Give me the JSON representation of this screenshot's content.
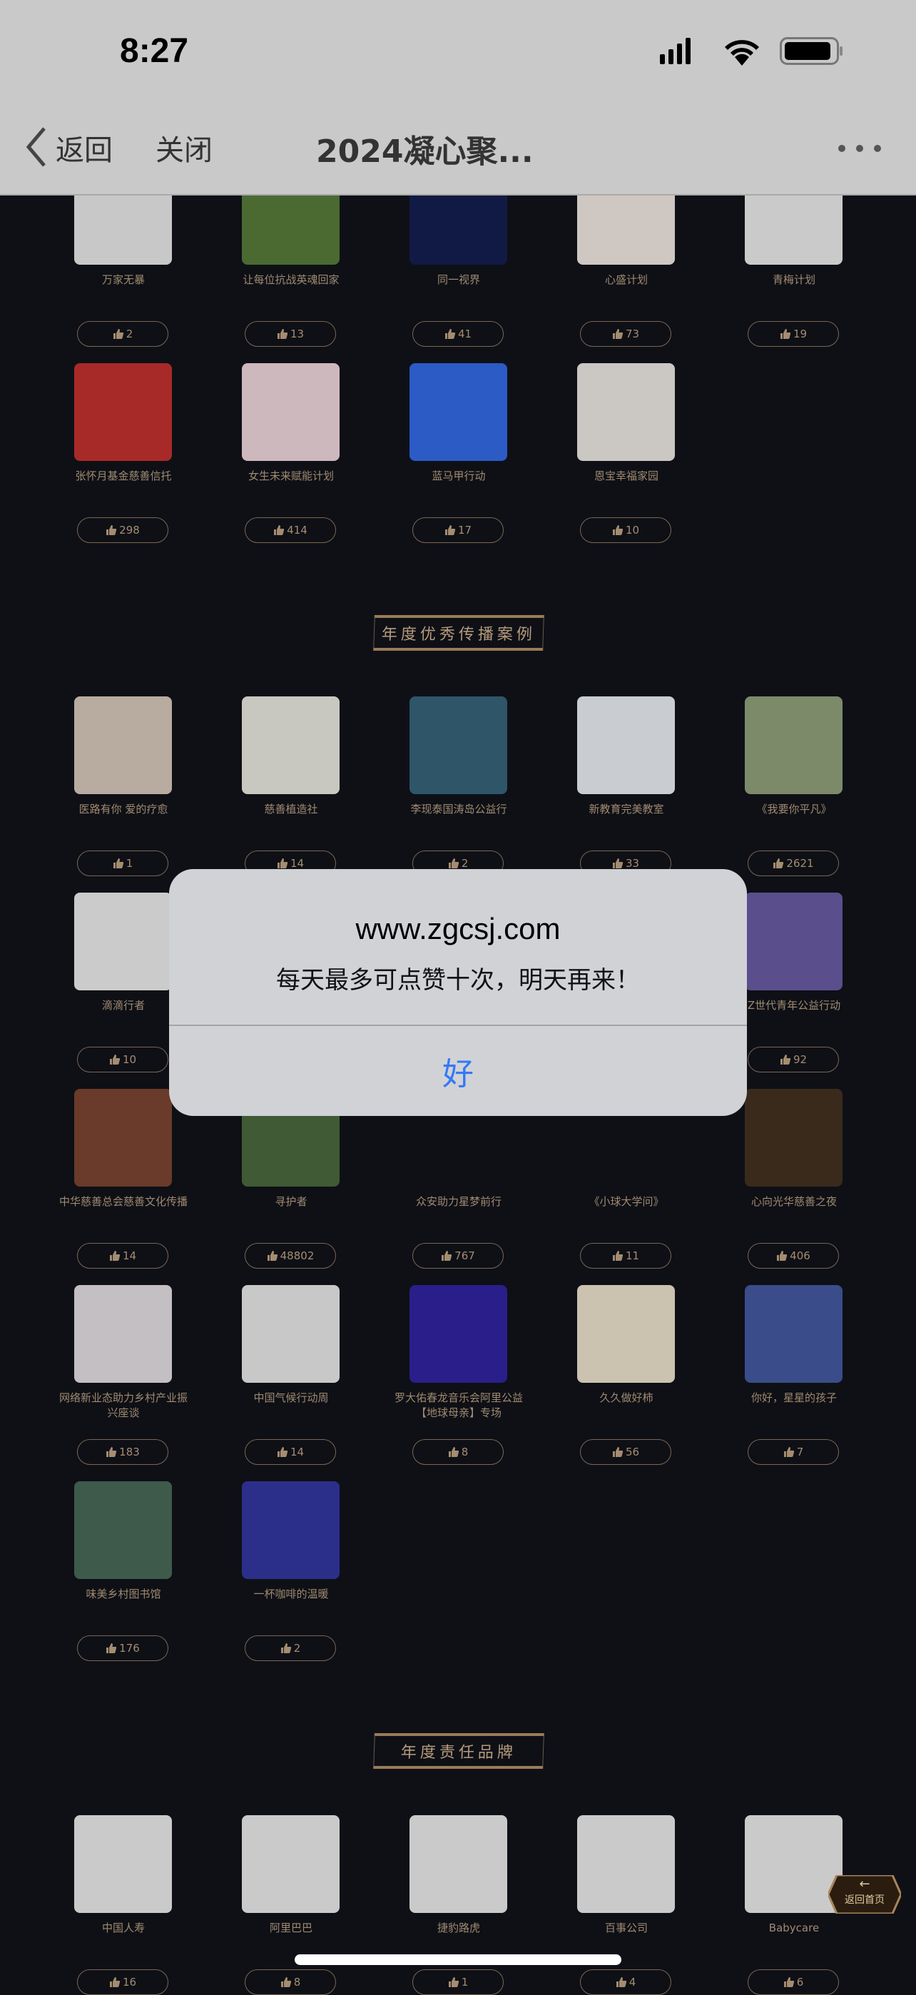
{
  "status_bar": {
    "time": "8:27",
    "icons": [
      "cellular-signal-icon",
      "wifi-icon",
      "battery-icon"
    ]
  },
  "nav": {
    "back_label": "返回",
    "close_label": "关闭",
    "title": "2024凝心聚...",
    "more_icon": "more-dots-icon"
  },
  "colors": {
    "background": "#0e1016",
    "gold": "#b69b7c",
    "dialog_button": "#3478f6"
  },
  "sections": [
    {
      "heading": "",
      "items": [
        {
          "label": "万家无暴",
          "likes": "2",
          "color": "#c8c8c8"
        },
        {
          "label": "让每位抗战英魂回家",
          "likes": "13",
          "color": "#4a6a32"
        },
        {
          "label": "同一视界",
          "likes": "41",
          "color": "#111a44"
        },
        {
          "label": "心盛计划",
          "likes": "73",
          "color": "#cfc8c2"
        },
        {
          "label": "青梅计划",
          "likes": "19",
          "color": "#cacaca"
        },
        {
          "label": "张怀月基金慈善信托",
          "likes": "298",
          "color": "#a82a28"
        },
        {
          "label": "女生未来赋能计划",
          "likes": "414",
          "color": "#cdb8bd"
        },
        {
          "label": "蓝马甲行动",
          "likes": "17",
          "color": "#2c5bc6"
        },
        {
          "label": "恩宝幸福家园",
          "likes": "10",
          "color": "#cbc7c3"
        }
      ]
    },
    {
      "heading": "年度优秀传播案例",
      "items": [
        {
          "label": "医路有你 爱的疗愈",
          "likes": "1",
          "color": "#b8aba0"
        },
        {
          "label": "慈善植造社",
          "likes": "14",
          "color": "#c8c8c0"
        },
        {
          "label": "李现泰国涛岛公益行",
          "likes": "2",
          "color": "#2f5568"
        },
        {
          "label": "新教育完美教室",
          "likes": "33",
          "color": "#c9ccd0"
        },
        {
          "label": "《我要你平凡》",
          "likes": "2621",
          "color": "#7c8a6a"
        },
        {
          "label": "滴滴行者",
          "likes": "10",
          "color": "#cbcbcb"
        },
        null,
        null,
        null,
        {
          "label": "Z世代青年公益行动",
          "likes": "92",
          "color": "#5a4f8c"
        },
        {
          "label": "中华慈善总会慈善文化传播",
          "likes": "14",
          "color": "#6a3a2a"
        },
        {
          "label": "寻护者",
          "likes": "48802",
          "color": "#3f5a35"
        },
        {
          "label": "众安助力星梦前行",
          "likes": "767",
          "color": "#0e1016"
        },
        {
          "label": "《小球大学问》",
          "likes": "11",
          "color": "#0e1016"
        },
        {
          "label": "心向光华慈善之夜",
          "likes": "406",
          "color": "#3a2a1c"
        },
        {
          "label": "网络新业态助力乡村产业振兴座谈",
          "likes": "183",
          "color": "#c4bfc2"
        },
        {
          "label": "中国气候行动周",
          "likes": "14",
          "color": "#c8c8c8"
        },
        {
          "label": "罗大佑春龙音乐会阿里公益【地球母亲】专场",
          "likes": "8",
          "color": "#2a1f8a"
        },
        {
          "label": "久久做好柿",
          "likes": "56",
          "color": "#cbc3b0"
        },
        {
          "label": "你好，星星的孩子",
          "likes": "7",
          "color": "#3a4c8a"
        },
        {
          "label": "味美乡村图书馆",
          "likes": "176",
          "color": "#3e5a4a"
        },
        {
          "label": "一杯咖啡的温暖",
          "likes": "2",
          "color": "#2c2f8a"
        }
      ]
    },
    {
      "heading": "年度责任品牌",
      "items": [
        {
          "label": "中国人寿",
          "likes": "16",
          "color": "#cacaca"
        },
        {
          "label": "阿里巴巴",
          "likes": "8",
          "color": "#cacaca"
        },
        {
          "label": "捷豹路虎",
          "likes": "1",
          "color": "#cacaca"
        },
        {
          "label": "百事公司",
          "likes": "4",
          "color": "#cacaca"
        },
        {
          "label": "Babycare",
          "likes": "6",
          "color": "#cacaca"
        }
      ]
    }
  ],
  "dialog": {
    "title": "www.zgcsj.com",
    "message": "每天最多可点赞十次，明天再来！",
    "ok_label": "好"
  },
  "back_home": {
    "label": "返回首页",
    "icon": "arrow-left-icon"
  }
}
